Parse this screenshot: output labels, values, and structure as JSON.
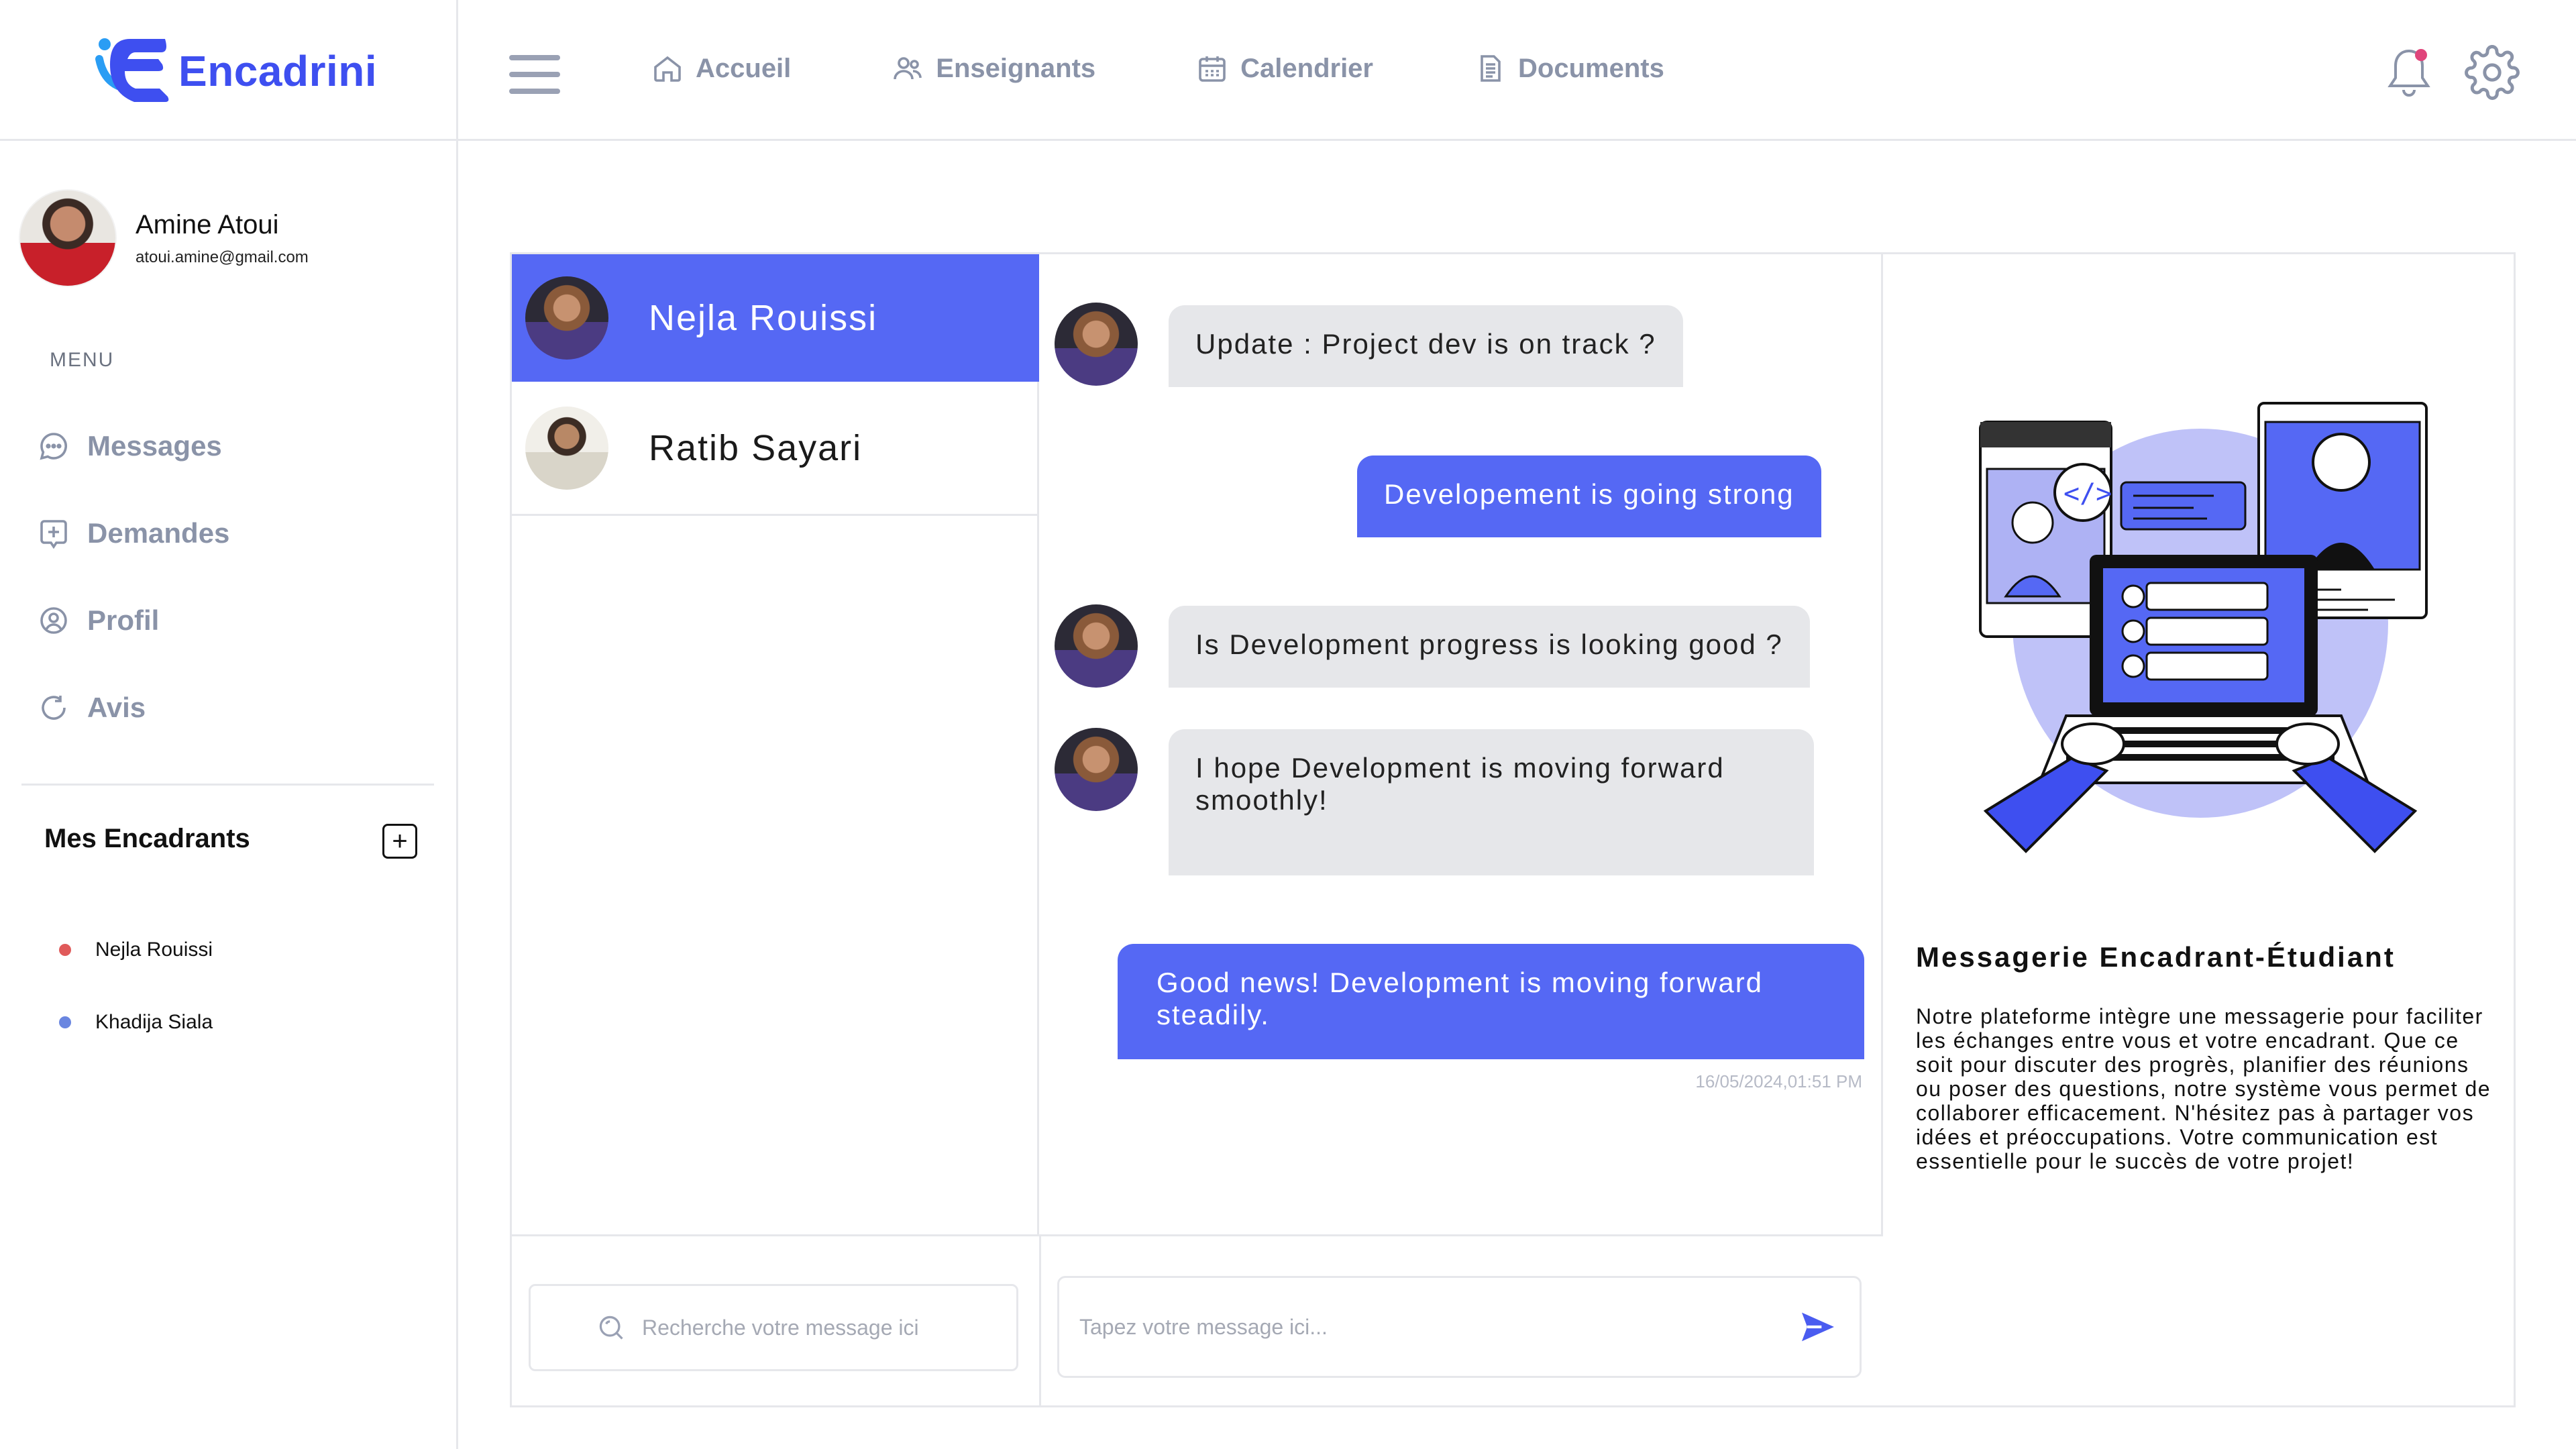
{
  "app": {
    "name": "Encadrini",
    "accent": "#5568f4",
    "logo_color": "#3e4ff0"
  },
  "sidebar": {
    "user": {
      "name": "Amine Atoui",
      "email": "atoui.amine@gmail.com"
    },
    "menu_title": "MENU",
    "items": [
      {
        "label": "Messages",
        "icon": "chat-bubble-icon"
      },
      {
        "label": "Demandes",
        "icon": "plus-square-icon"
      },
      {
        "label": "Profil",
        "icon": "user-circle-icon"
      },
      {
        "label": "Avis",
        "icon": "refresh-icon"
      }
    ],
    "encadrants_title": "Mes Encadrants",
    "encadrants": [
      {
        "name": "Nejla Rouissi",
        "color": "#e05a5a"
      },
      {
        "name": "Khadija Siala",
        "color": "#6a86e0"
      }
    ]
  },
  "topnav": {
    "items": [
      {
        "label": "Accueil",
        "icon": "home-icon"
      },
      {
        "label": "Enseignants",
        "icon": "users-icon"
      },
      {
        "label": "Calendrier",
        "icon": "calendar-icon"
      },
      {
        "label": "Documents",
        "icon": "document-icon"
      }
    ],
    "notification_dot_color": "#e0457b"
  },
  "contacts": [
    {
      "name": "Nejla Rouissi",
      "active": true
    },
    {
      "name": "Ratib Sayari",
      "active": false
    }
  ],
  "messages": [
    {
      "from": "in",
      "text": "Update : Project dev is on track ?"
    },
    {
      "from": "out",
      "text": "Developement is going strong"
    },
    {
      "from": "in",
      "text": "Is Development progress is looking good ?"
    },
    {
      "from": "in",
      "text": "I hope Development is moving forward smoothly!"
    },
    {
      "from": "out",
      "text": "Good news! Development is moving forward steadily."
    }
  ],
  "last_timestamp": "16/05/2024,01:51 PM",
  "search": {
    "placeholder": "Recherche votre message ici"
  },
  "composer": {
    "placeholder": "Tapez votre message ici..."
  },
  "info": {
    "title": "Messagerie Encadrant-Étudiant",
    "text": "Notre plateforme intègre une messagerie pour faciliter les échanges entre vous et votre encadrant. Que ce soit pour discuter des progrès, planifier des réunions ou poser des questions, notre système vous permet de collaborer efficacement. N'hésitez pas à partager vos idées et préoccupations. Votre communication est essentielle pour le succès de votre projet!"
  }
}
